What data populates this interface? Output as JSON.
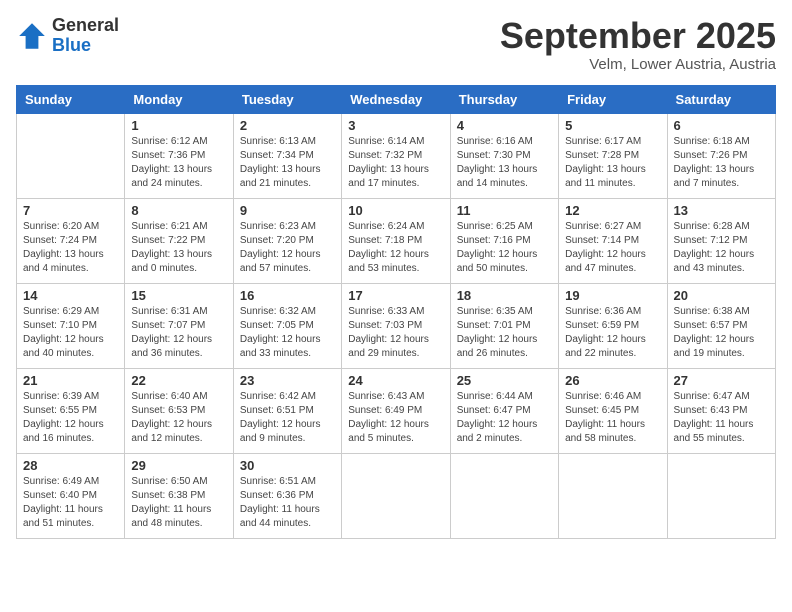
{
  "logo": {
    "general": "General",
    "blue": "Blue"
  },
  "title": "September 2025",
  "location": "Velm, Lower Austria, Austria",
  "days_of_week": [
    "Sunday",
    "Monday",
    "Tuesday",
    "Wednesday",
    "Thursday",
    "Friday",
    "Saturday"
  ],
  "weeks": [
    [
      {
        "day": "",
        "info": ""
      },
      {
        "day": "1",
        "info": "Sunrise: 6:12 AM\nSunset: 7:36 PM\nDaylight: 13 hours and 24 minutes."
      },
      {
        "day": "2",
        "info": "Sunrise: 6:13 AM\nSunset: 7:34 PM\nDaylight: 13 hours and 21 minutes."
      },
      {
        "day": "3",
        "info": "Sunrise: 6:14 AM\nSunset: 7:32 PM\nDaylight: 13 hours and 17 minutes."
      },
      {
        "day": "4",
        "info": "Sunrise: 6:16 AM\nSunset: 7:30 PM\nDaylight: 13 hours and 14 minutes."
      },
      {
        "day": "5",
        "info": "Sunrise: 6:17 AM\nSunset: 7:28 PM\nDaylight: 13 hours and 11 minutes."
      },
      {
        "day": "6",
        "info": "Sunrise: 6:18 AM\nSunset: 7:26 PM\nDaylight: 13 hours and 7 minutes."
      }
    ],
    [
      {
        "day": "7",
        "info": "Sunrise: 6:20 AM\nSunset: 7:24 PM\nDaylight: 13 hours and 4 minutes."
      },
      {
        "day": "8",
        "info": "Sunrise: 6:21 AM\nSunset: 7:22 PM\nDaylight: 13 hours and 0 minutes."
      },
      {
        "day": "9",
        "info": "Sunrise: 6:23 AM\nSunset: 7:20 PM\nDaylight: 12 hours and 57 minutes."
      },
      {
        "day": "10",
        "info": "Sunrise: 6:24 AM\nSunset: 7:18 PM\nDaylight: 12 hours and 53 minutes."
      },
      {
        "day": "11",
        "info": "Sunrise: 6:25 AM\nSunset: 7:16 PM\nDaylight: 12 hours and 50 minutes."
      },
      {
        "day": "12",
        "info": "Sunrise: 6:27 AM\nSunset: 7:14 PM\nDaylight: 12 hours and 47 minutes."
      },
      {
        "day": "13",
        "info": "Sunrise: 6:28 AM\nSunset: 7:12 PM\nDaylight: 12 hours and 43 minutes."
      }
    ],
    [
      {
        "day": "14",
        "info": "Sunrise: 6:29 AM\nSunset: 7:10 PM\nDaylight: 12 hours and 40 minutes."
      },
      {
        "day": "15",
        "info": "Sunrise: 6:31 AM\nSunset: 7:07 PM\nDaylight: 12 hours and 36 minutes."
      },
      {
        "day": "16",
        "info": "Sunrise: 6:32 AM\nSunset: 7:05 PM\nDaylight: 12 hours and 33 minutes."
      },
      {
        "day": "17",
        "info": "Sunrise: 6:33 AM\nSunset: 7:03 PM\nDaylight: 12 hours and 29 minutes."
      },
      {
        "day": "18",
        "info": "Sunrise: 6:35 AM\nSunset: 7:01 PM\nDaylight: 12 hours and 26 minutes."
      },
      {
        "day": "19",
        "info": "Sunrise: 6:36 AM\nSunset: 6:59 PM\nDaylight: 12 hours and 22 minutes."
      },
      {
        "day": "20",
        "info": "Sunrise: 6:38 AM\nSunset: 6:57 PM\nDaylight: 12 hours and 19 minutes."
      }
    ],
    [
      {
        "day": "21",
        "info": "Sunrise: 6:39 AM\nSunset: 6:55 PM\nDaylight: 12 hours and 16 minutes."
      },
      {
        "day": "22",
        "info": "Sunrise: 6:40 AM\nSunset: 6:53 PM\nDaylight: 12 hours and 12 minutes."
      },
      {
        "day": "23",
        "info": "Sunrise: 6:42 AM\nSunset: 6:51 PM\nDaylight: 12 hours and 9 minutes."
      },
      {
        "day": "24",
        "info": "Sunrise: 6:43 AM\nSunset: 6:49 PM\nDaylight: 12 hours and 5 minutes."
      },
      {
        "day": "25",
        "info": "Sunrise: 6:44 AM\nSunset: 6:47 PM\nDaylight: 12 hours and 2 minutes."
      },
      {
        "day": "26",
        "info": "Sunrise: 6:46 AM\nSunset: 6:45 PM\nDaylight: 11 hours and 58 minutes."
      },
      {
        "day": "27",
        "info": "Sunrise: 6:47 AM\nSunset: 6:43 PM\nDaylight: 11 hours and 55 minutes."
      }
    ],
    [
      {
        "day": "28",
        "info": "Sunrise: 6:49 AM\nSunset: 6:40 PM\nDaylight: 11 hours and 51 minutes."
      },
      {
        "day": "29",
        "info": "Sunrise: 6:50 AM\nSunset: 6:38 PM\nDaylight: 11 hours and 48 minutes."
      },
      {
        "day": "30",
        "info": "Sunrise: 6:51 AM\nSunset: 6:36 PM\nDaylight: 11 hours and 44 minutes."
      },
      {
        "day": "",
        "info": ""
      },
      {
        "day": "",
        "info": ""
      },
      {
        "day": "",
        "info": ""
      },
      {
        "day": "",
        "info": ""
      }
    ]
  ]
}
